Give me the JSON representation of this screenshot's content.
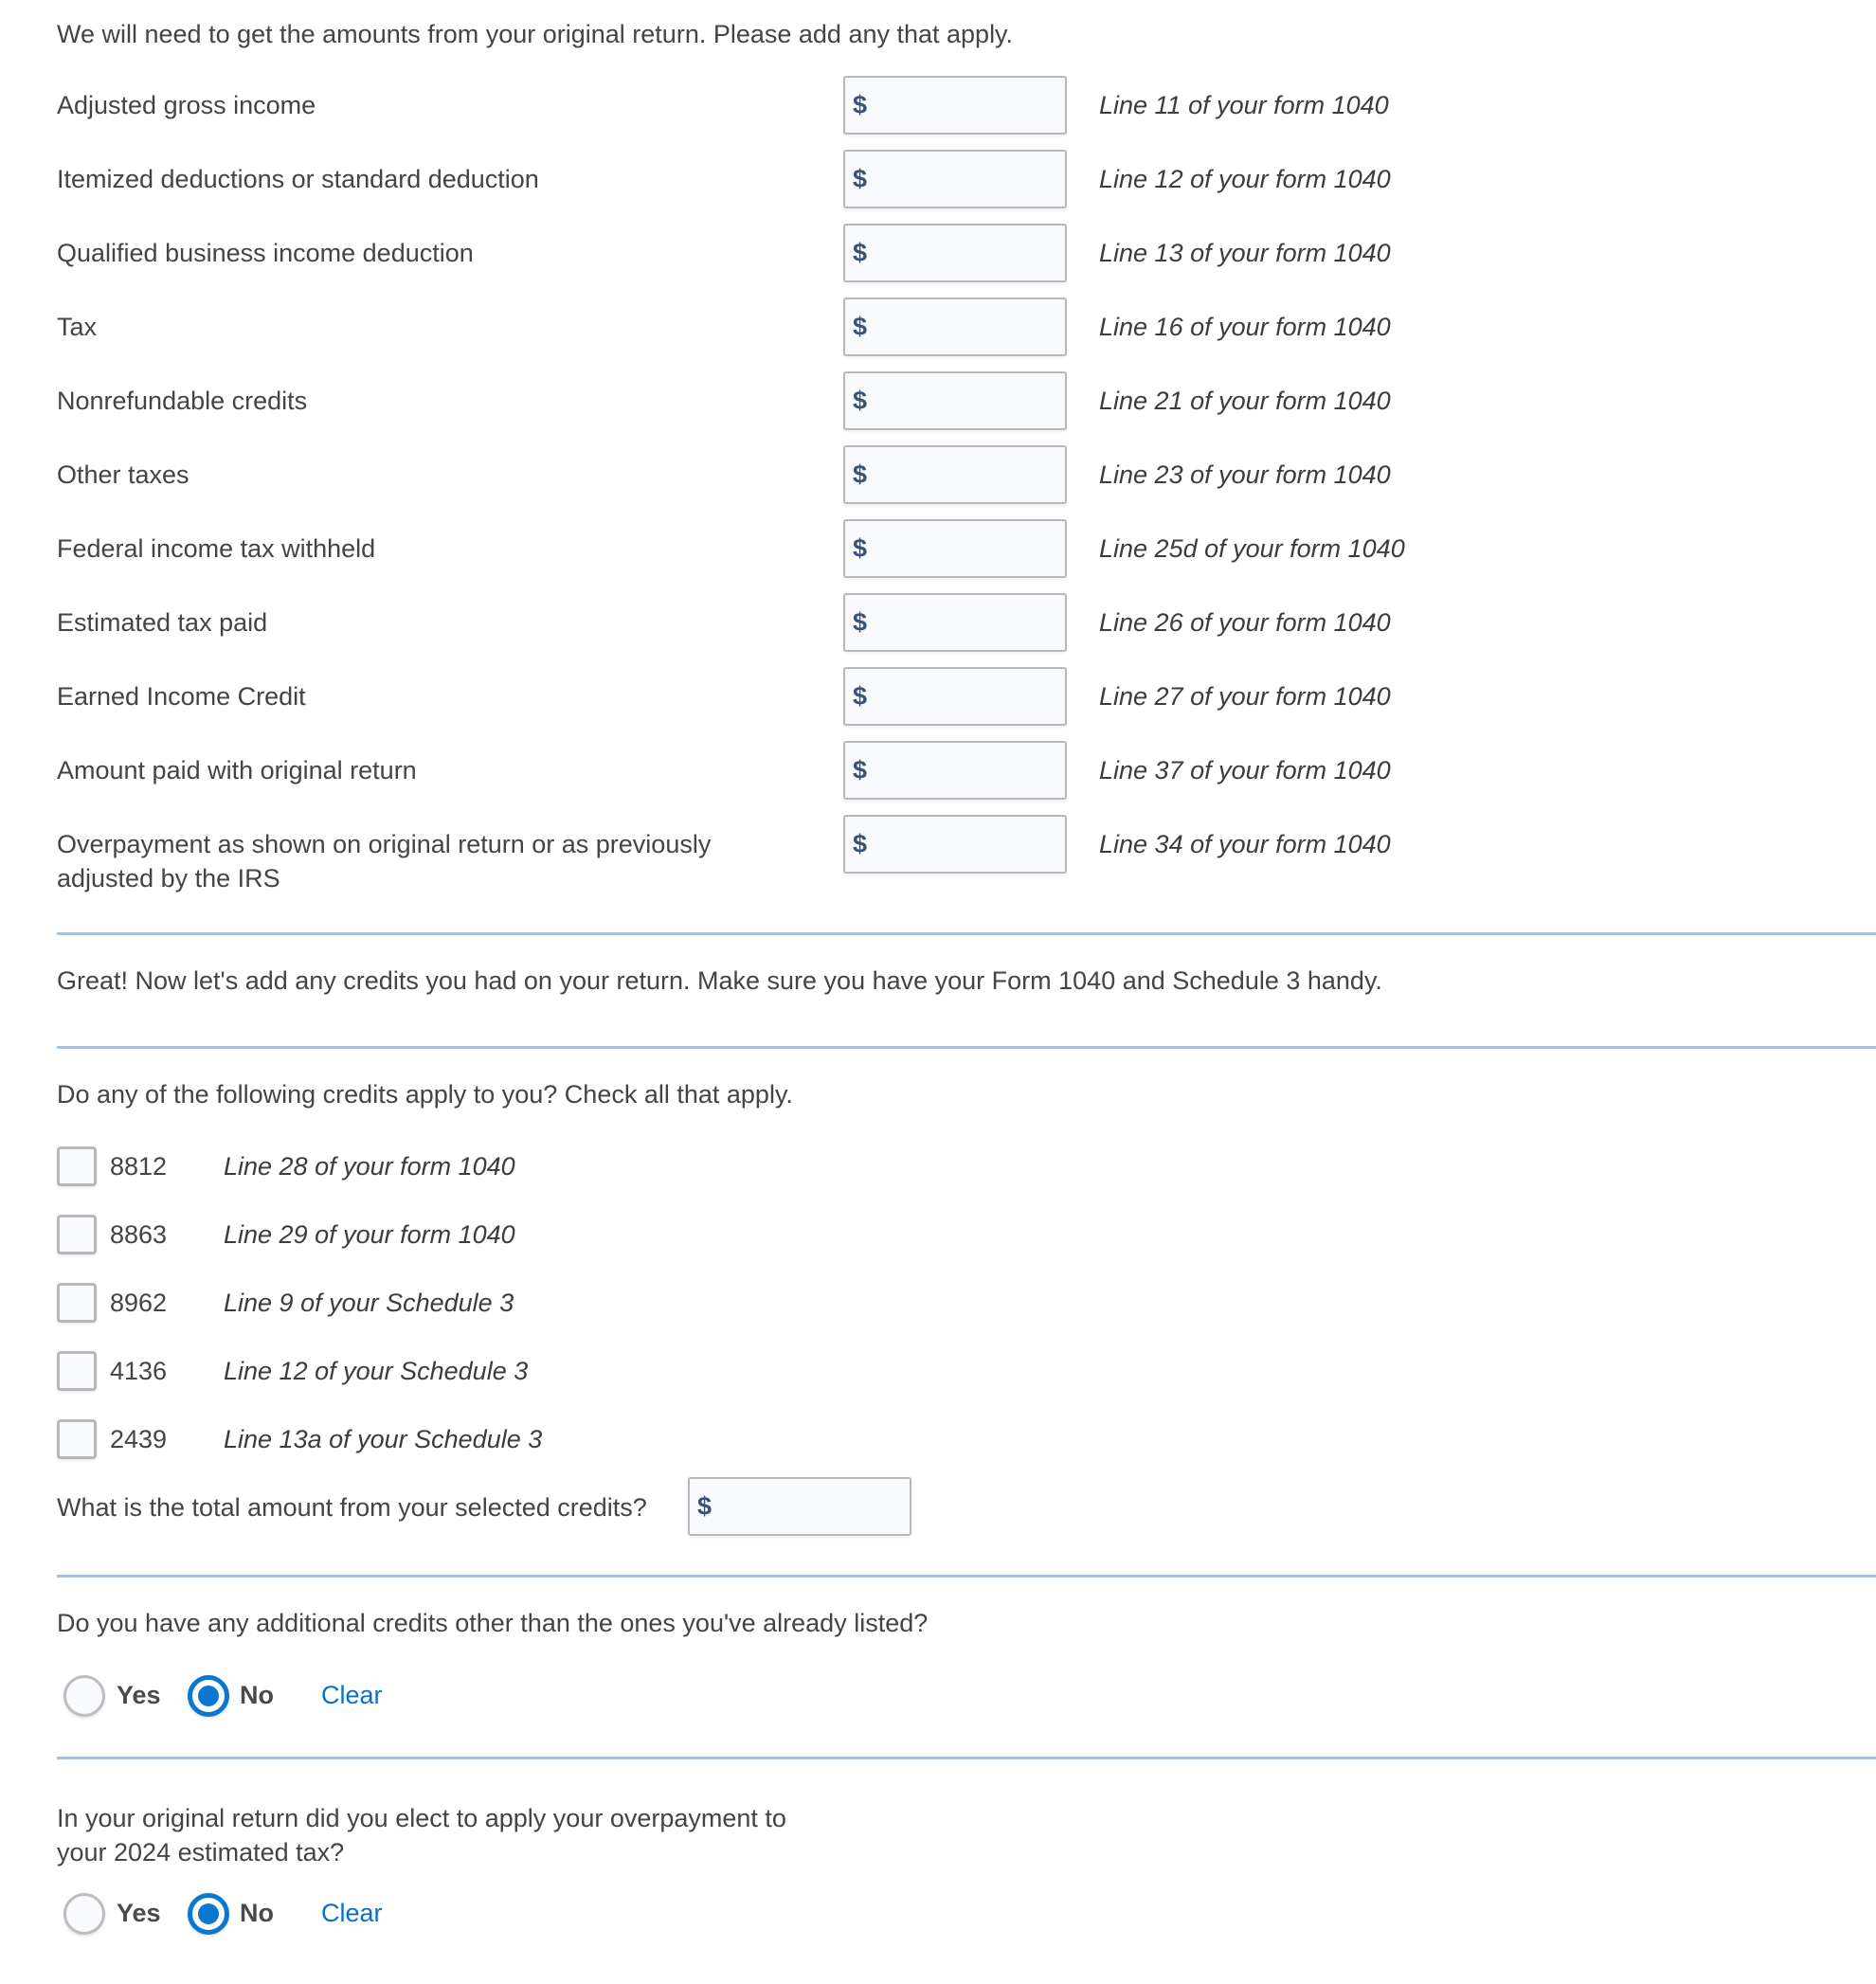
{
  "intro": "We will need to get the amounts from your original return. Please add any that apply.",
  "currency_symbol": "$",
  "amount_rows": [
    {
      "label": "Adjusted gross income",
      "value": "",
      "hint": "Line 11 of your form 1040"
    },
    {
      "label": "Itemized deductions or standard deduction",
      "value": "",
      "hint": "Line 12 of your form 1040"
    },
    {
      "label": "Qualified business income deduction",
      "value": "",
      "hint": "Line 13 of your form 1040"
    },
    {
      "label": "Tax",
      "value": "",
      "hint": "Line 16 of your form 1040"
    },
    {
      "label": "Nonrefundable credits",
      "value": "",
      "hint": "Line 21 of your form 1040"
    },
    {
      "label": "Other taxes",
      "value": "",
      "hint": "Line 23 of your form 1040"
    },
    {
      "label": "Federal income tax withheld",
      "value": "",
      "hint": "Line 25d of your form 1040"
    },
    {
      "label": "Estimated tax paid",
      "value": "",
      "hint": "Line 26 of your form 1040"
    },
    {
      "label": "Earned Income Credit",
      "value": "",
      "hint": "Line 27 of your form 1040"
    },
    {
      "label": "Amount paid with original return",
      "value": "",
      "hint": "Line 37 of your form 1040"
    },
    {
      "label_line1": "Overpayment as shown on original return or as previously",
      "label_line2": "adjusted by the IRS",
      "value": "",
      "hint": "Line 34 of your form 1040"
    }
  ],
  "credits_intro": "Great! Now let's add any credits you had on your return. Make sure you have your Form 1040 and Schedule 3 handy.",
  "credits_question": "Do any of the following credits apply to you? Check all that apply.",
  "credits": [
    {
      "code": "8812",
      "hint": "Line 28 of your form 1040",
      "checked": false
    },
    {
      "code": "8863",
      "hint": "Line 29 of your form 1040",
      "checked": false
    },
    {
      "code": "8962",
      "hint": "Line 9 of your Schedule 3",
      "checked": false
    },
    {
      "code": "4136",
      "hint": "Line 12 of your Schedule 3",
      "checked": false
    },
    {
      "code": "2439",
      "hint": "Line 13a of your Schedule 3",
      "checked": false
    }
  ],
  "total_credits": {
    "label": "What is the total amount from your selected credits?",
    "value": ""
  },
  "additional_credits": {
    "question": "Do you have any additional credits other than the ones you've already listed?",
    "yes_label": "Yes",
    "no_label": "No",
    "clear_label": "Clear",
    "selected": "No"
  },
  "overpayment_election": {
    "question_line1": "In your original return did you elect to apply your overpayment to",
    "question_line2": "your 2024 estimated tax?",
    "yes_label": "Yes",
    "no_label": "No",
    "clear_label": "Clear",
    "selected": "No"
  },
  "colors": {
    "accent": "#0b77cf",
    "link": "#0b6fc7",
    "divider": "#a9c0e0",
    "text": "#444444"
  }
}
